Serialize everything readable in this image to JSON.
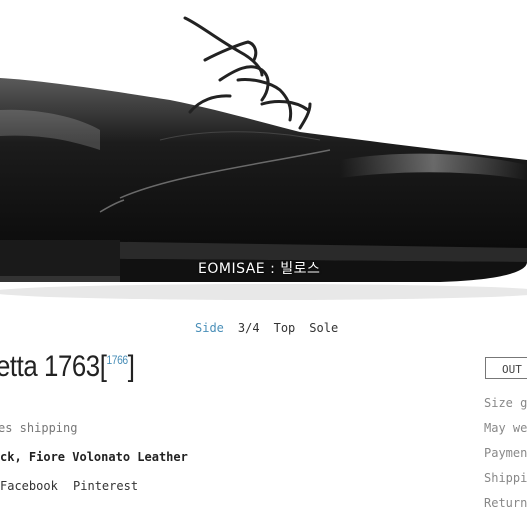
{
  "watermark": "EOMISAE : 빌로스",
  "view_tabs": [
    "Side",
    "3/4",
    "Top",
    "Sole"
  ],
  "product": {
    "title": "etta 1763",
    "bracket_open": "[",
    "alt_number": "1766",
    "bracket_close": "]",
    "shipping": "es shipping",
    "material": "ck, Fiore Volonato Leather"
  },
  "share": [
    "Facebook",
    "Pinterest"
  ],
  "out_button": "OUT",
  "side_links": [
    "Size gui",
    "May we ",
    "Payment",
    "Shippin",
    "Returns"
  ],
  "colors": {
    "active_tab": "#4a8fb8",
    "shoe": "#111111"
  }
}
